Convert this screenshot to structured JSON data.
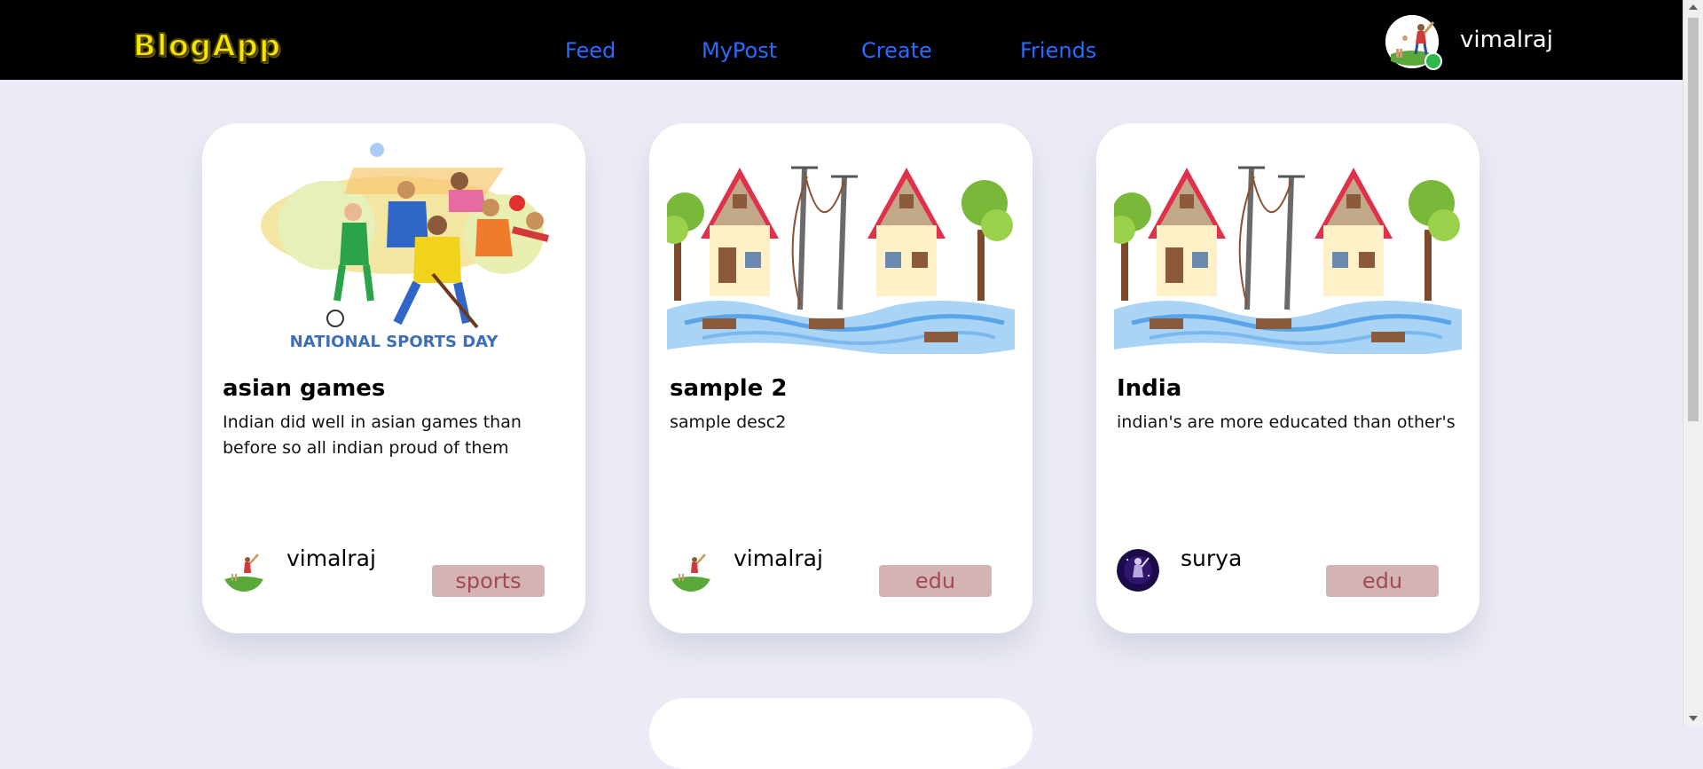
{
  "nav": {
    "logo": "BlogApp",
    "links": [
      "Feed",
      "MyPost",
      "Create",
      "Friends"
    ],
    "username": "vimalraj"
  },
  "posts": [
    {
      "image": "national-sports-day-illustration",
      "image_caption": "NATIONAL SPORTS DAY",
      "title": "asian games",
      "desc": "Indian did well in asian games than before so all indian proud of them",
      "author": "vimalraj",
      "tag": "sports"
    },
    {
      "image": "flood-houses-illustration",
      "title": "sample 2",
      "desc": "sample desc2",
      "author": "vimalraj",
      "tag": "edu"
    },
    {
      "image": "flood-houses-illustration",
      "title": "India",
      "desc": "indian's are more educated than other's",
      "author": "surya",
      "tag": "edu"
    }
  ],
  "colors": {
    "nav_bg": "#000000",
    "link": "#2a6bff",
    "page_bg": "#eaebf4",
    "tag_bg": "#d4b3b5",
    "tag_text": "#a24a52",
    "logo": "#f6e600"
  }
}
